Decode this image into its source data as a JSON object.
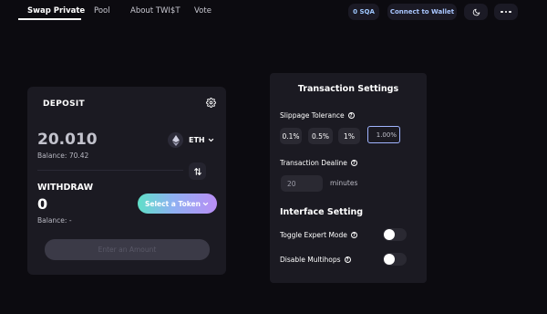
{
  "nav": {
    "tabs": [
      {
        "label": "Swap Private",
        "active": true
      },
      {
        "label": "Pool",
        "active": false
      },
      {
        "label": "About TWI$T",
        "active": false
      },
      {
        "label": "Vote",
        "active": false
      }
    ],
    "balance_pill": "0 SQA",
    "connect_label": "Connect to Wallet",
    "theme_icon": "moon-icon",
    "more_icon": "more-dots-icon"
  },
  "swap": {
    "deposit_title": "DEPOSIT",
    "deposit_amount": "20.010",
    "deposit_balance": "Balance: 70.42",
    "deposit_token": "ETH",
    "withdraw_title": "WITHDRAW",
    "withdraw_amount": "0",
    "withdraw_balance": "Balance: -",
    "select_token_label": "Select a Token",
    "submit_label": "Enter an Amount"
  },
  "settings": {
    "title": "Transaction Settings",
    "slippage_label": "Slippage Tolerance",
    "slippage_options": [
      "0.1%",
      "0.5%",
      "1%"
    ],
    "slippage_value": "1.00%",
    "deadline_label": "Transaction Dealine",
    "deadline_value": "20",
    "deadline_unit": "minutes",
    "interface_title": "Interface Setting",
    "expert_mode_label": "Toggle Expert Mode",
    "expert_mode_on": false,
    "multihops_label": "Disable Multihops",
    "multihops_on": false
  },
  "colors": {
    "background": "#0c0b10",
    "card": "#1b1a22",
    "accent_gradient_start": "#5fe0c8",
    "accent_gradient_end": "#b98ef5",
    "focus_border": "#a0b4ff"
  }
}
